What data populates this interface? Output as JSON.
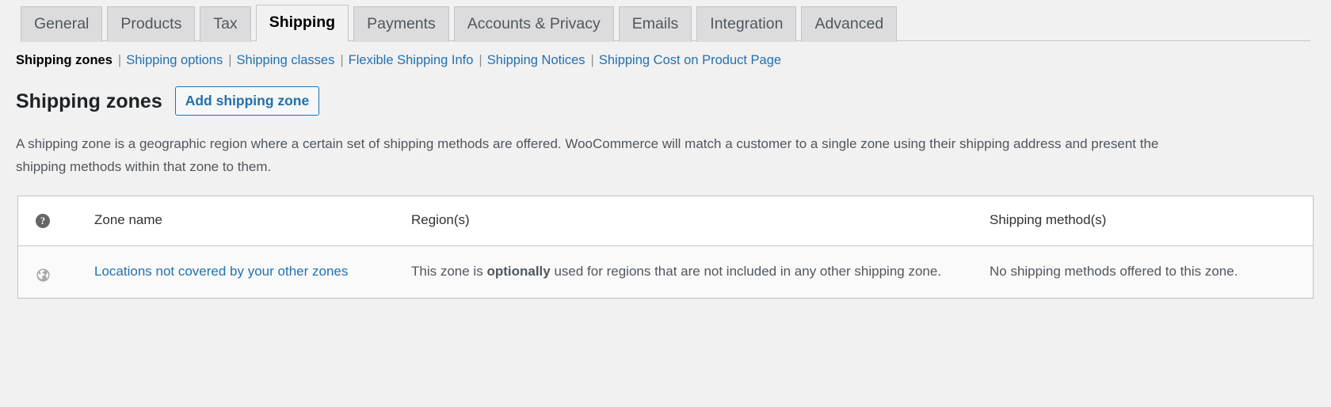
{
  "tabs": [
    {
      "label": "General",
      "active": false
    },
    {
      "label": "Products",
      "active": false
    },
    {
      "label": "Tax",
      "active": false
    },
    {
      "label": "Shipping",
      "active": true
    },
    {
      "label": "Payments",
      "active": false
    },
    {
      "label": "Accounts & Privacy",
      "active": false
    },
    {
      "label": "Emails",
      "active": false
    },
    {
      "label": "Integration",
      "active": false
    },
    {
      "label": "Advanced",
      "active": false
    }
  ],
  "subnav": [
    {
      "label": "Shipping zones",
      "current": true
    },
    {
      "label": "Shipping options",
      "current": false
    },
    {
      "label": "Shipping classes",
      "current": false
    },
    {
      "label": "Flexible Shipping Info",
      "current": false
    },
    {
      "label": "Shipping Notices",
      "current": false
    },
    {
      "label": "Shipping Cost on Product Page",
      "current": false
    }
  ],
  "separator": "|",
  "page": {
    "title": "Shipping zones",
    "action_label": "Add shipping zone",
    "description": "A shipping zone is a geographic region where a certain set of shipping methods are offered. WooCommerce will match a customer to a single zone using their shipping address and present the shipping methods within that zone to them."
  },
  "table": {
    "help_tip": "?",
    "headers": {
      "zone_name": "Zone name",
      "regions": "Region(s)",
      "methods": "Shipping method(s)"
    },
    "rows": [
      {
        "icon": "globe-icon",
        "zone_name": "Locations not covered by your other zones",
        "region_prefix": "This zone is ",
        "region_emphasis": "optionally",
        "region_suffix": " used for regions that are not included in any other shipping zone.",
        "methods": "No shipping methods offered to this zone."
      }
    ]
  },
  "colors": {
    "link": "#2271b1",
    "background": "#f1f1f1",
    "tab_inactive": "#dcdcde",
    "border": "#c3c4c7",
    "row_background": "#fafafa"
  }
}
